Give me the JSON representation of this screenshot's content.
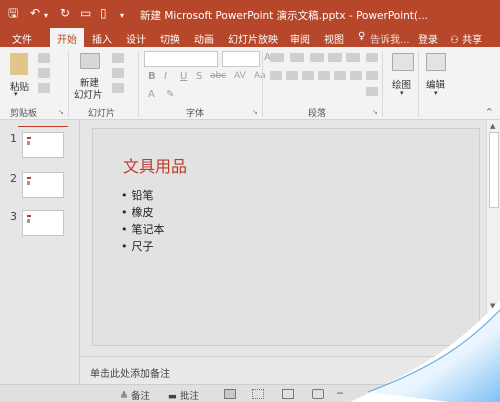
{
  "titlebar": {
    "title": "新建 Microsoft PowerPoint 演示文稿.pptx - PowerPoint(...",
    "accent": "#b7472a"
  },
  "tabs": [
    "文件",
    "开始",
    "插入",
    "设计",
    "切换",
    "动画",
    "幻灯片放映",
    "审阅",
    "视图"
  ],
  "tab_active": "开始",
  "tell_me": "告诉我...",
  "login": "登录",
  "share": "共享",
  "ribbon": {
    "clipboard": {
      "paste": "粘贴",
      "label": "剪贴板"
    },
    "slides": {
      "new_slide_line1": "新建",
      "new_slide_line2": "幻灯片",
      "label": "幻灯片"
    },
    "font": {
      "label": "字体",
      "bold": "B",
      "italic": "I",
      "underline": "U",
      "strike": "S",
      "shadow": "abc",
      "spacing": "AV",
      "case": "Aa",
      "color": "A"
    },
    "paragraph": {
      "label": "段落"
    },
    "drawing": {
      "label": "绘图"
    },
    "editing": {
      "label": "编辑"
    }
  },
  "slides_pane": [
    "1",
    "2",
    "3"
  ],
  "current_slide": {
    "title": "文具用品",
    "bullets": [
      "铅笔",
      "橡皮",
      "笔记本",
      "尺子"
    ],
    "title_color": "#c0392b"
  },
  "notes_placeholder": "单击此处添加备注",
  "statusbar": {
    "notes": "备注",
    "comments": "批注"
  }
}
